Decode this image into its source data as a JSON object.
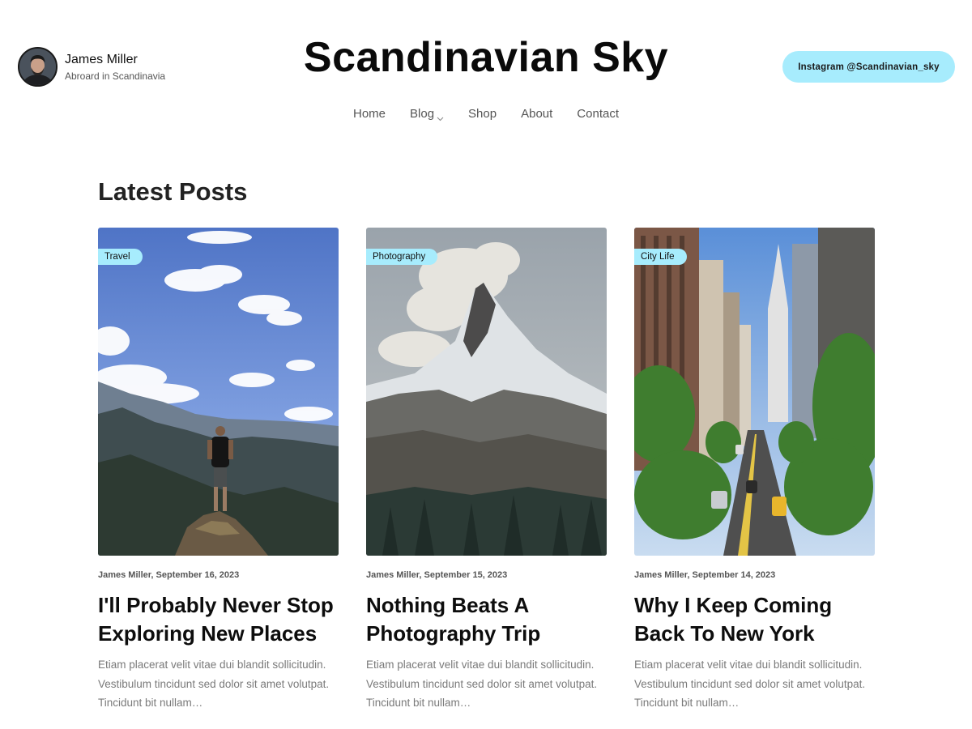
{
  "author": {
    "name": "James Miller",
    "subtitle": "Abroard in Scandinavia"
  },
  "site": {
    "title": "Scandinavian Sky"
  },
  "header": {
    "instagram_label": "Instagram @Scandinavian_sky"
  },
  "nav": {
    "items": [
      {
        "label": "Home"
      },
      {
        "label": "Blog",
        "icon": "chevron-down-icon"
      },
      {
        "label": "Shop"
      },
      {
        "label": "About"
      },
      {
        "label": "Contact"
      }
    ]
  },
  "section": {
    "title": "Latest Posts"
  },
  "posts": [
    {
      "tag": "Travel",
      "meta": "James Miller, September 16, 2023",
      "title": "I'll Probably Never Stop Exploring New Places",
      "excerpt": "Etiam placerat velit vitae dui blandit sollicitudin. Vestibulum tincidunt sed dolor sit amet volutpat. Tincidunt bit nullam…",
      "image": "hiker-on-mountain-peak"
    },
    {
      "tag": "Photography",
      "meta": "James Miller, September 15, 2023",
      "title": "Nothing Beats A Photography Trip",
      "excerpt": "Etiam placerat velit vitae dui blandit sollicitudin. Vestibulum tincidunt sed dolor sit amet volutpat. Tincidunt bit nullam…",
      "image": "snowy-mountain-peak"
    },
    {
      "tag": "City Life",
      "meta": "James Miller, September 14, 2023",
      "title": "Why I Keep Coming Back To New York",
      "excerpt": "Etiam placerat velit vitae dui blandit sollicitudin. Vestibulum tincidunt sed dolor sit amet volutpat. Tincidunt bit nullam…",
      "image": "new-york-street"
    }
  ],
  "colors": {
    "accent": "#a7ecfd",
    "text": "#0d0d0d",
    "muted": "#7a7a7a"
  }
}
